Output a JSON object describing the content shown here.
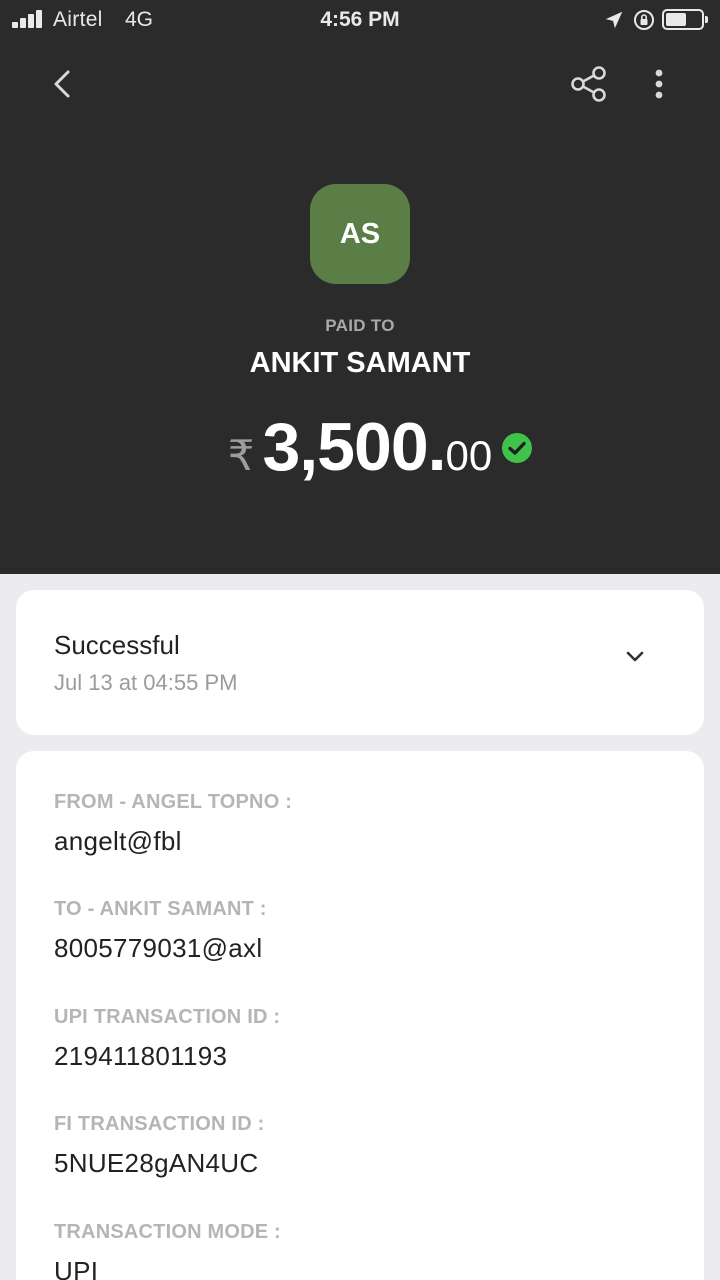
{
  "status_bar": {
    "carrier": "Airtel",
    "network": "4G",
    "time": "4:56 PM",
    "icons": [
      "signal-icon",
      "location-arrow-icon",
      "rotation-lock-icon",
      "battery-icon"
    ]
  },
  "header": {
    "icons": [
      "back-icon",
      "share-icon",
      "more-vertical-icon"
    ]
  },
  "payee": {
    "initials": "AS",
    "paid_to_label": "PAID TO",
    "name": "ANKIT SAMANT",
    "avatar_color": "#5b7e46"
  },
  "amount": {
    "currency_symbol": "₹",
    "whole": "3,500.",
    "decimal": "00",
    "status_icon": "check-circle-icon",
    "success_color": "#3fc34a"
  },
  "status_card": {
    "status": "Successful",
    "timestamp": "Jul 13 at 04:55 PM",
    "icon": "chevron-down-icon"
  },
  "details": [
    {
      "label": "FROM - ANGEL TOPNO :",
      "value": "angelt@fbl"
    },
    {
      "label": "TO - ANKIT SAMANT :",
      "value": "8005779031@axl"
    },
    {
      "label": "UPI TRANSACTION ID :",
      "value": "219411801193"
    },
    {
      "label": "FI TRANSACTION ID :",
      "value": "5NUE28gAN4UC"
    },
    {
      "label": "TRANSACTION MODE :",
      "value": "UPI"
    }
  ],
  "colors": {
    "header_bg": "#2b2b2b",
    "page_bg": "#ececee"
  }
}
